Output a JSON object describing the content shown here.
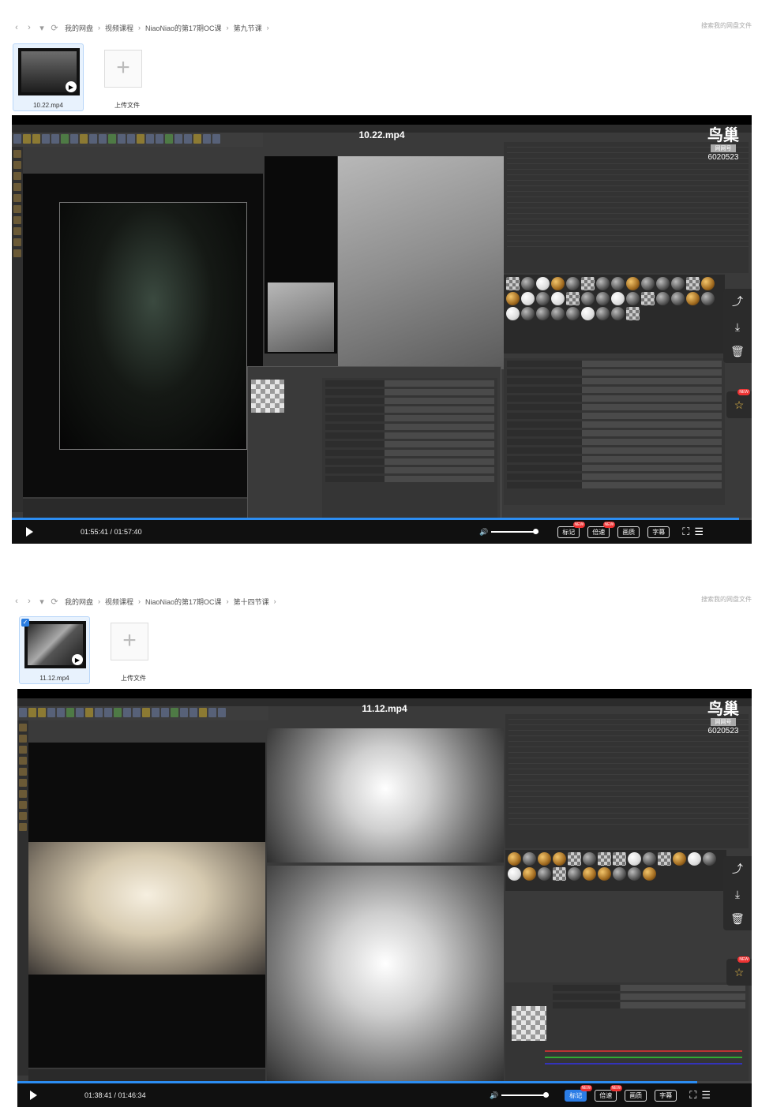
{
  "panel1": {
    "breadcrumb": [
      "我的网盘",
      "视频课程",
      "NiaoNiao的第17期OC课",
      "第九节课"
    ],
    "search_placeholder": "搜索我的网盘文件",
    "file": {
      "name": "10.22.mp4"
    },
    "upload_label": "上传文件",
    "player": {
      "title": "10.22.mp4",
      "time": "01:55:41 / 01:57:40",
      "progress": 0.983,
      "buttons": [
        "标记",
        "倍速",
        "画质",
        "字幕"
      ],
      "watermark": {
        "logo": "鸟巢",
        "sub": "网网号",
        "id": "6020523"
      }
    }
  },
  "panel2": {
    "breadcrumb": [
      "我的网盘",
      "视频课程",
      "NiaoNiao的第17期OC课",
      "第十四节课"
    ],
    "search_placeholder": "搜索我的网盘文件",
    "file": {
      "name": "11.12.mp4"
    },
    "upload_label": "上传文件",
    "player": {
      "title": "11.12.mp4",
      "time": "01:38:41 / 01:46:34",
      "progress": 0.926,
      "buttons": [
        "标记",
        "倍速",
        "画质",
        "字幕"
      ],
      "watermark": {
        "logo": "鸟巢",
        "sub": "网网号",
        "id": "6020523"
      }
    }
  },
  "icons": {
    "back": "‹",
    "forward": "›",
    "dropdown": "▾",
    "refresh": "⟳",
    "sep": "›",
    "plus": "+",
    "share": "⤴",
    "download": "⤓",
    "delete": "🗑",
    "pin": "☆",
    "volume": "🔊",
    "fullscreen": "⛶",
    "playlist": "☰",
    "new": "NEW"
  },
  "colors": {
    "accent": "#2b7de6",
    "selected_tile_bg": "#e8f2fd",
    "new_badge": "#e33333"
  }
}
